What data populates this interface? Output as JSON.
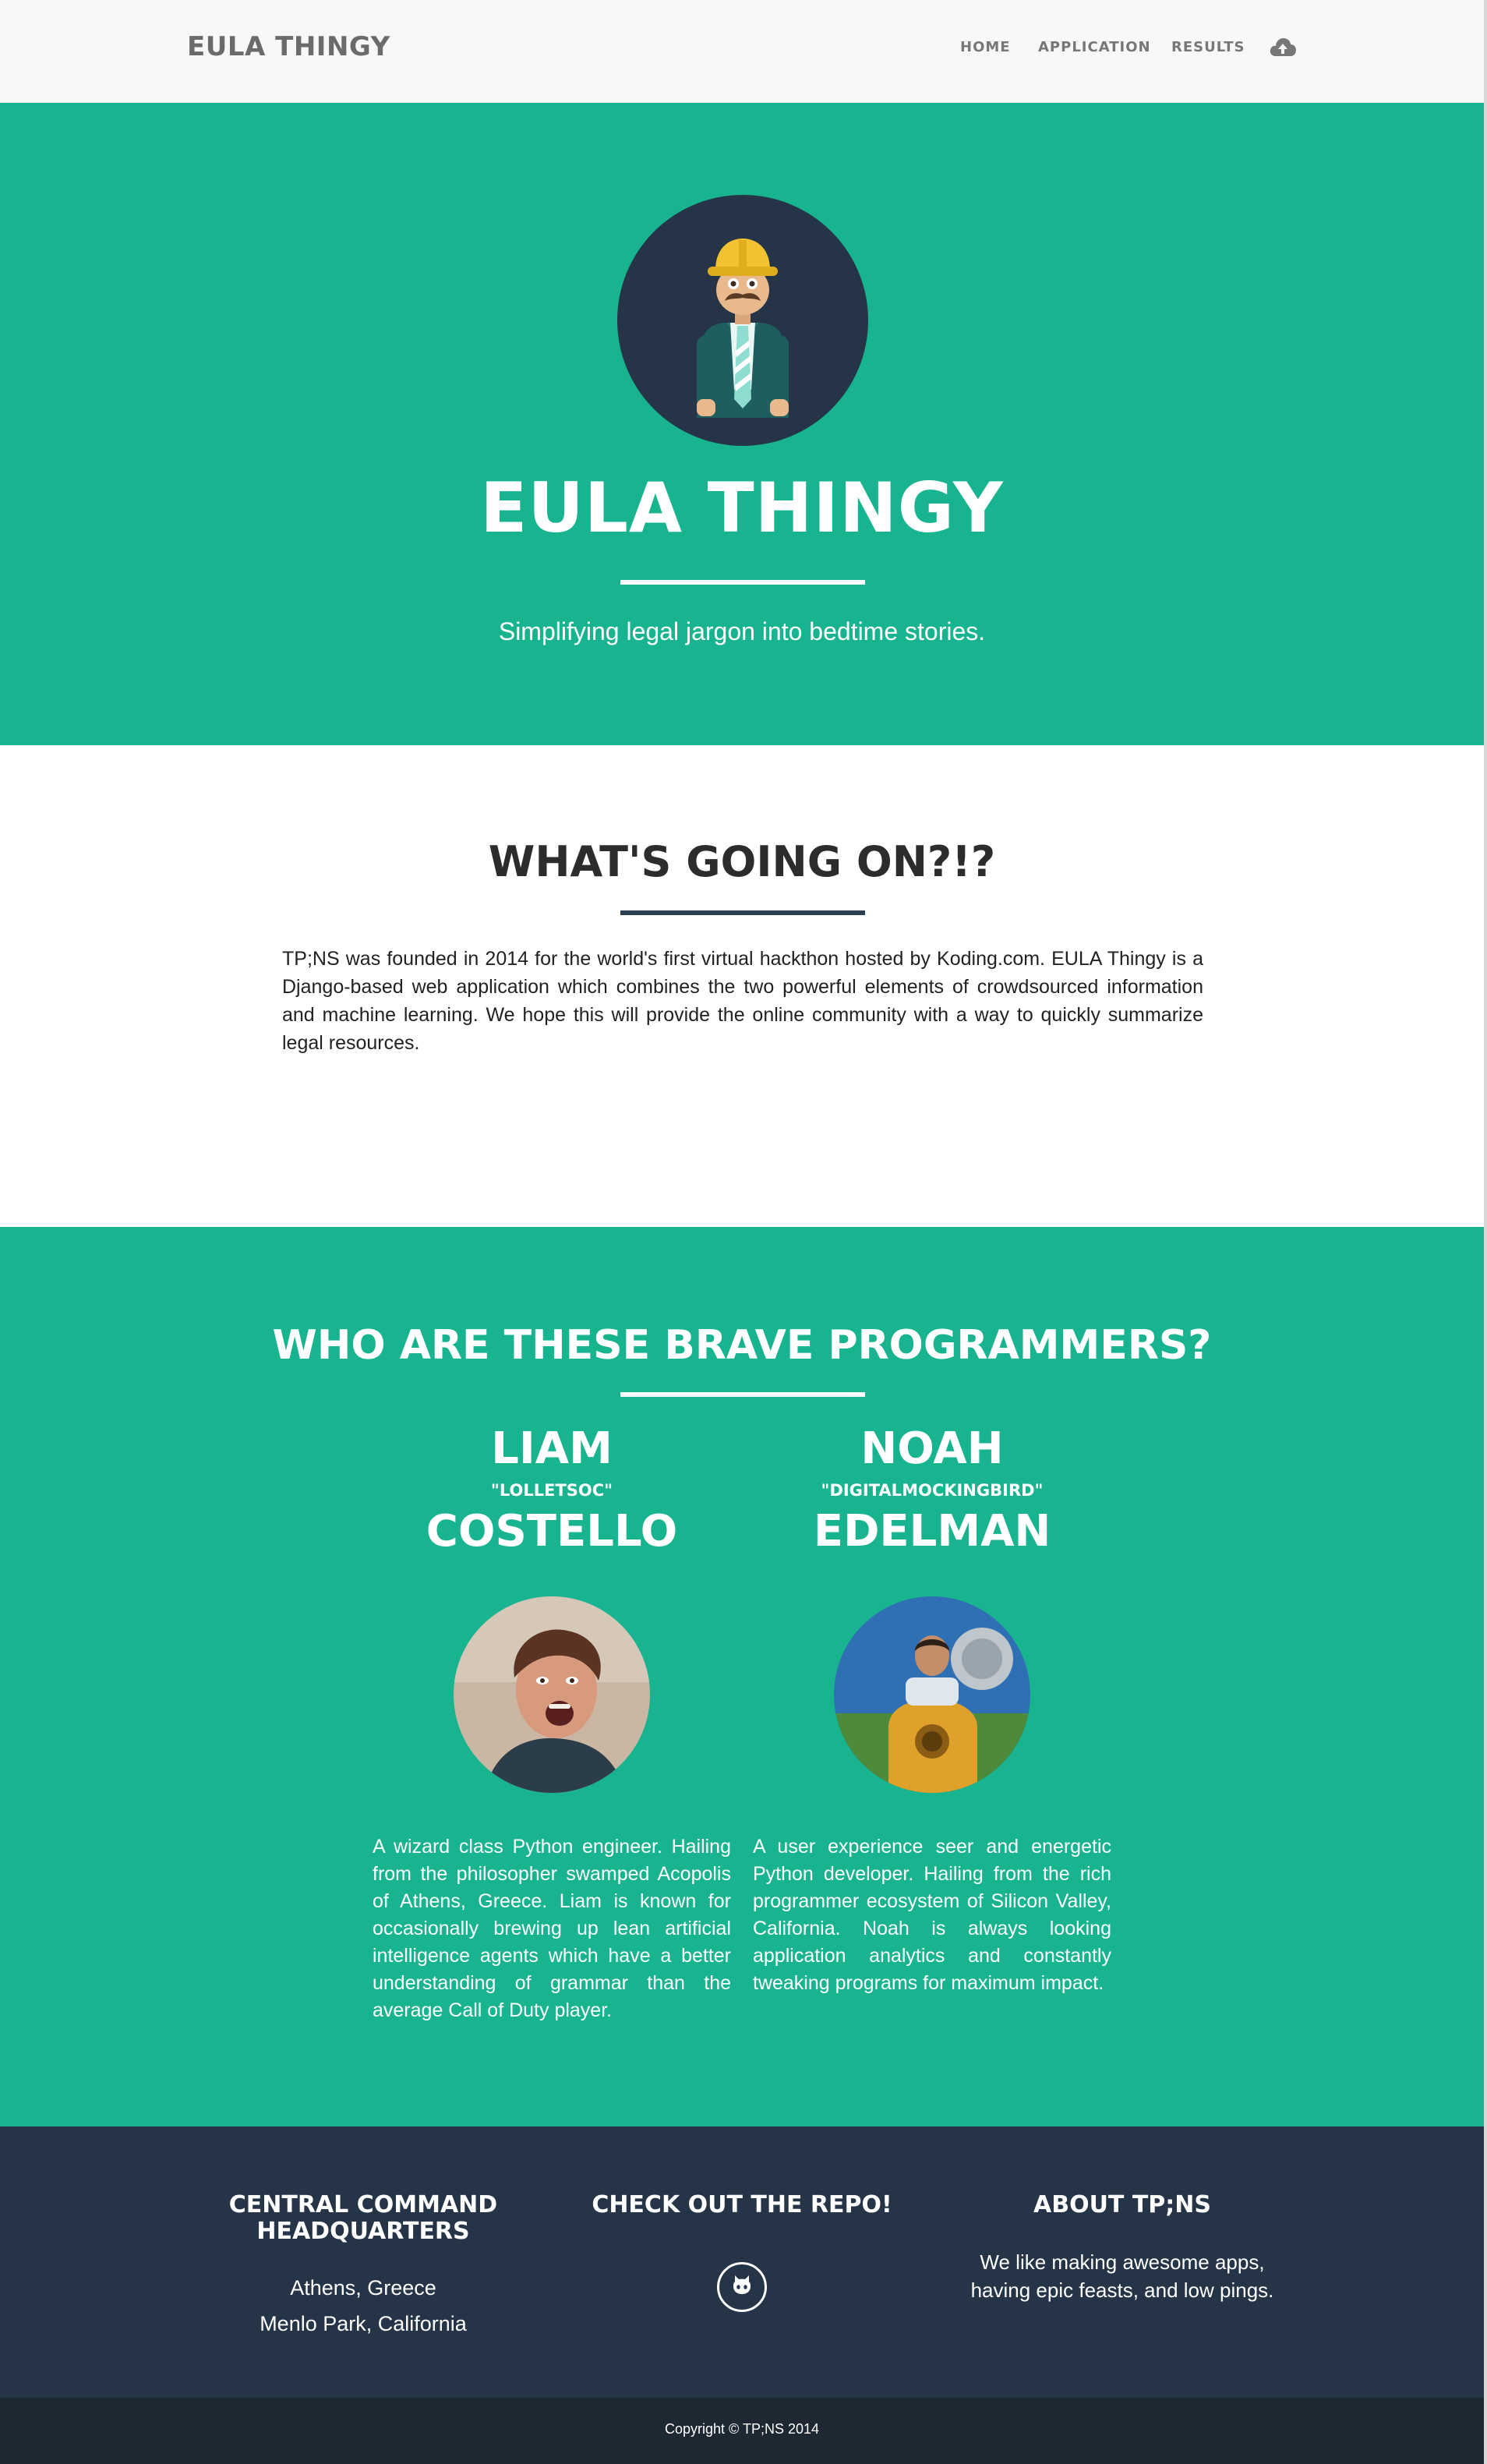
{
  "navbar": {
    "brand": "EULA THINGY",
    "items": [
      {
        "label": "HOME"
      },
      {
        "label": "APPLICATION"
      },
      {
        "label": "RESULTS"
      }
    ],
    "upload_icon": "cloud-upload-icon"
  },
  "header": {
    "avatar_icon": "mascot-construction-worker",
    "title": "EULA THINGY",
    "subtitle": "Simplifying legal jargon into bedtime stories."
  },
  "about": {
    "title": "WHAT'S GOING ON?!?",
    "text": "TP;NS was founded in 2014 for the world's first virtual hackthon hosted by Koding.com. EULA Thingy is a Django-based web application which combines the two powerful elements of crowdsourced information and machine learning. We hope this will provide the online community with a way to quickly summarize legal resources."
  },
  "team": {
    "title": "WHO ARE THESE BRAVE PROGRAMMERS?",
    "members": [
      {
        "first": "LIAM",
        "nickname": "\"LOLLETSOC\"",
        "last": "COSTELLO",
        "bio": "A wizard class Python engineer. Hailing from the philosopher swamped Acopolis of Athens, Greece. Liam is known for occasionally brewing up lean artificial intelligence agents which have a better understanding of grammar than the average Call of Duty player."
      },
      {
        "first": "NOAH",
        "nickname": "\"DIGITALMOCKINGBIRD\"",
        "last": "EDELMAN",
        "bio": "A user experience seer and energetic Python developer. Hailing from the rich programmer ecosystem of Silicon Valley, California. Noah is always looking application analytics and constantly tweaking programs for maximum impact."
      }
    ]
  },
  "footer": {
    "hq": {
      "heading": "CENTRAL COMMAND HEADQUARTERS",
      "lines": [
        "Athens, Greece",
        "Menlo Park, California"
      ]
    },
    "repo": {
      "heading": "CHECK OUT THE REPO!",
      "icon": "github-icon"
    },
    "about": {
      "heading": "ABOUT TP;NS",
      "text": "We like making awesome apps, having epic feasts, and low pings."
    },
    "copyright": "Copyright © TP;NS 2014"
  },
  "colors": {
    "accent": "#18b48f",
    "dark": "#253446",
    "darker": "#1e2833",
    "navbar_bg": "#f8f8f8"
  }
}
